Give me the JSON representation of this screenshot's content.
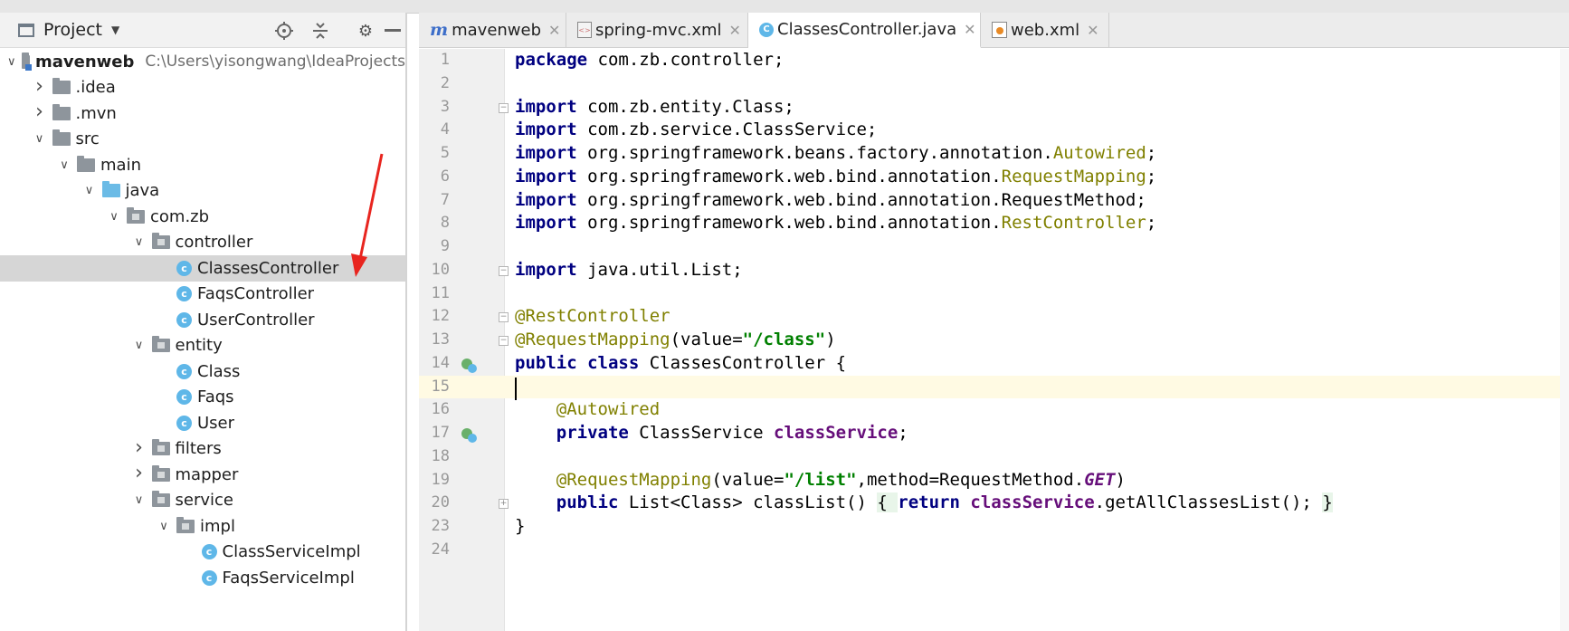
{
  "project_panel": {
    "title": "Project",
    "tree": [
      {
        "label": "mavenweb",
        "path": "C:\\Users\\yisongwang\\IdeaProjects",
        "level": 0,
        "chevron": "open",
        "icon": "module-folder-icon",
        "bold": true
      },
      {
        "label": ".idea",
        "level": 1,
        "chevron": "closed",
        "icon": "folder-icon"
      },
      {
        "label": ".mvn",
        "level": 1,
        "chevron": "closed",
        "icon": "folder-icon"
      },
      {
        "label": "src",
        "level": 1,
        "chevron": "open",
        "icon": "folder-icon"
      },
      {
        "label": "main",
        "level": 2,
        "chevron": "open",
        "icon": "folder-icon"
      },
      {
        "label": "java",
        "level": 3,
        "chevron": "open",
        "icon": "source-folder-icon"
      },
      {
        "label": "com.zb",
        "level": 4,
        "chevron": "open",
        "icon": "package-icon"
      },
      {
        "label": "controller",
        "level": 5,
        "chevron": "open",
        "icon": "package-icon"
      },
      {
        "label": "ClassesController",
        "level": 6,
        "chevron": "none",
        "icon": "class-icon",
        "selected": true
      },
      {
        "label": "FaqsController",
        "level": 6,
        "chevron": "none",
        "icon": "class-icon"
      },
      {
        "label": "UserController",
        "level": 6,
        "chevron": "none",
        "icon": "class-icon"
      },
      {
        "label": "entity",
        "level": 5,
        "chevron": "open",
        "icon": "package-icon"
      },
      {
        "label": "Class",
        "level": 6,
        "chevron": "none",
        "icon": "class-icon"
      },
      {
        "label": "Faqs",
        "level": 6,
        "chevron": "none",
        "icon": "class-icon"
      },
      {
        "label": "User",
        "level": 6,
        "chevron": "none",
        "icon": "class-icon"
      },
      {
        "label": "filters",
        "level": 5,
        "chevron": "closed",
        "icon": "package-icon"
      },
      {
        "label": "mapper",
        "level": 5,
        "chevron": "closed",
        "icon": "package-icon"
      },
      {
        "label": "service",
        "level": 5,
        "chevron": "open",
        "icon": "package-icon"
      },
      {
        "label": "impl",
        "level": 6,
        "chevron": "open",
        "icon": "package-icon"
      },
      {
        "label": "ClassServiceImpl",
        "level": 7,
        "chevron": "none",
        "icon": "class-icon"
      },
      {
        "label": "FaqsServiceImpl",
        "level": 7,
        "chevron": "none",
        "icon": "class-icon"
      }
    ]
  },
  "tabs": [
    {
      "label": "mavenweb",
      "icon": "maven-icon",
      "active": false
    },
    {
      "label": "spring-mvc.xml",
      "icon": "xml-file-icon",
      "active": false
    },
    {
      "label": "ClassesController.java",
      "icon": "class-icon",
      "active": true
    },
    {
      "label": "web.xml",
      "icon": "web-xml-icon",
      "active": false
    }
  ],
  "editor": {
    "current_line": "15",
    "lines": [
      {
        "num": "1",
        "tokens": [
          [
            "kw",
            "package"
          ],
          [
            "t",
            " com.zb.controller;"
          ]
        ]
      },
      {
        "num": "2",
        "tokens": []
      },
      {
        "num": "3",
        "fold": "open",
        "tokens": [
          [
            "kw",
            "import"
          ],
          [
            "t",
            " com.zb.entity.Class;"
          ]
        ]
      },
      {
        "num": "4",
        "tokens": [
          [
            "kw",
            "import"
          ],
          [
            "t",
            " com.zb.service.ClassService;"
          ]
        ]
      },
      {
        "num": "5",
        "tokens": [
          [
            "kw",
            "import"
          ],
          [
            "t",
            " org.springframework.beans.factory.annotation."
          ],
          [
            "ann",
            "Autowired"
          ],
          [
            "t",
            ";"
          ]
        ]
      },
      {
        "num": "6",
        "tokens": [
          [
            "kw",
            "import"
          ],
          [
            "t",
            " org.springframework.web.bind.annotation."
          ],
          [
            "ann",
            "RequestMapping"
          ],
          [
            "t",
            ";"
          ]
        ]
      },
      {
        "num": "7",
        "tokens": [
          [
            "kw",
            "import"
          ],
          [
            "t",
            " org.springframework.web.bind.annotation.RequestMethod;"
          ]
        ]
      },
      {
        "num": "8",
        "tokens": [
          [
            "kw",
            "import"
          ],
          [
            "t",
            " org.springframework.web.bind.annotation."
          ],
          [
            "ann",
            "RestController"
          ],
          [
            "t",
            ";"
          ]
        ]
      },
      {
        "num": "9",
        "tokens": []
      },
      {
        "num": "10",
        "fold": "close",
        "tokens": [
          [
            "kw",
            "import"
          ],
          [
            "t",
            " java.util.List;"
          ]
        ]
      },
      {
        "num": "11",
        "tokens": []
      },
      {
        "num": "12",
        "fold": "open",
        "tokens": [
          [
            "ann",
            "@RestController"
          ]
        ]
      },
      {
        "num": "13",
        "fold": "close",
        "tokens": [
          [
            "ann",
            "@RequestMapping"
          ],
          [
            "t",
            "(value="
          ],
          [
            "str",
            "\"/class\""
          ],
          [
            "t",
            ")"
          ]
        ]
      },
      {
        "num": "14",
        "mark": "bean-class-icon",
        "tokens": [
          [
            "kw",
            "public class"
          ],
          [
            "t",
            " ClassesController {"
          ]
        ]
      },
      {
        "num": "15",
        "tokens": []
      },
      {
        "num": "16",
        "tokens": [
          [
            "t",
            "    "
          ],
          [
            "ann",
            "@Autowired"
          ]
        ]
      },
      {
        "num": "17",
        "mark": "autowired-icon",
        "tokens": [
          [
            "t",
            "    "
          ],
          [
            "kw",
            "private"
          ],
          [
            "t",
            " ClassService "
          ],
          [
            "fld",
            "classService"
          ],
          [
            "t",
            ";"
          ]
        ]
      },
      {
        "num": "18",
        "tokens": []
      },
      {
        "num": "19",
        "tokens": [
          [
            "t",
            "    "
          ],
          [
            "ann",
            "@RequestMapping"
          ],
          [
            "t",
            "(value="
          ],
          [
            "str",
            "\"/list\""
          ],
          [
            "t",
            ",method=RequestMethod."
          ],
          [
            "ital",
            "GET"
          ],
          [
            "t",
            ")"
          ]
        ]
      },
      {
        "num": "20",
        "fold": "plus",
        "tokens": [
          [
            "t",
            "    "
          ],
          [
            "kw",
            "public"
          ],
          [
            "t",
            " List<Class> classList() "
          ],
          [
            "hl",
            "{ "
          ],
          [
            "kw",
            "return"
          ],
          [
            "t",
            " "
          ],
          [
            "fld",
            "classService"
          ],
          [
            "t",
            ".getAllClassesList(); "
          ],
          [
            "hl",
            "}"
          ]
        ]
      },
      {
        "num": "23",
        "tokens": [
          [
            "t",
            "}"
          ]
        ]
      },
      {
        "num": "24",
        "tokens": []
      }
    ]
  },
  "colors": {
    "keyword": "#000080",
    "annotation": "#808000",
    "string": "#008000",
    "field": "#660e7a",
    "arrow": "#e8251f",
    "current_line": "#fffae3",
    "selection": "#d6d6d6"
  }
}
